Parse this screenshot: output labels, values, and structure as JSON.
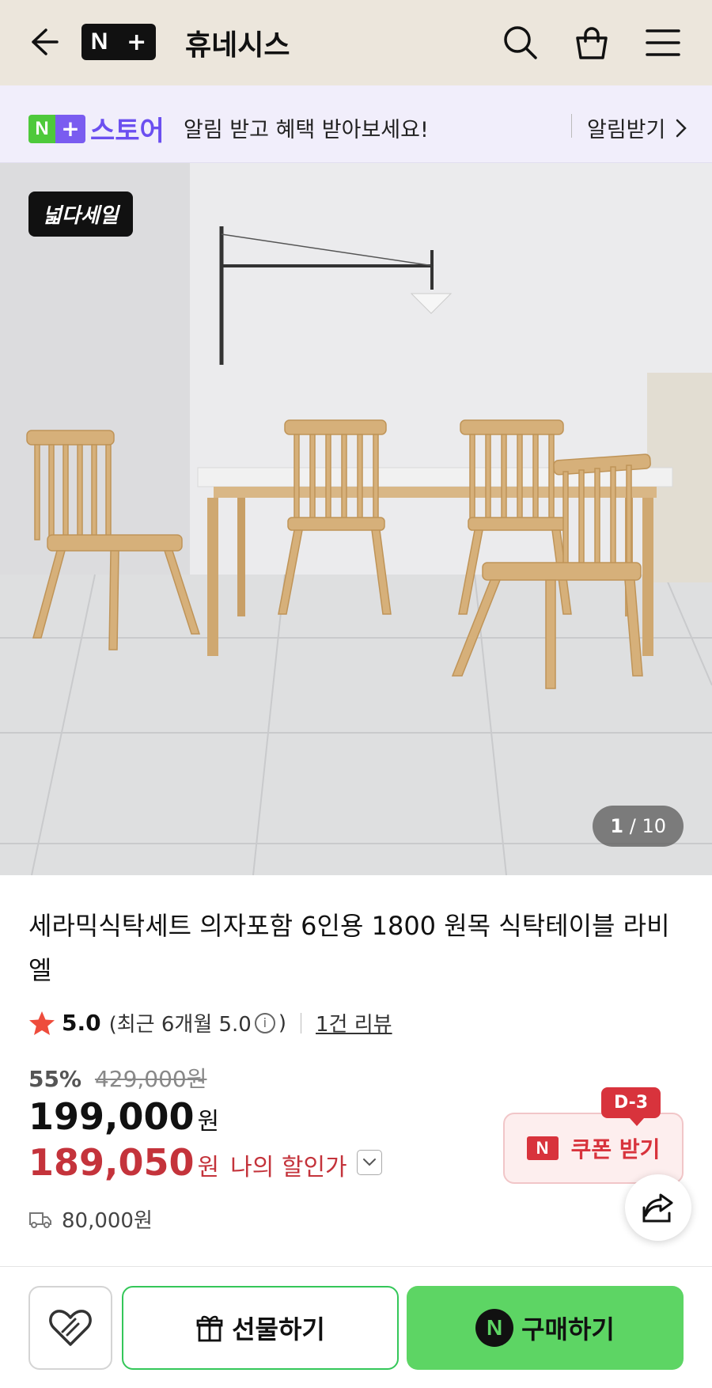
{
  "header": {
    "logo_n": "N",
    "logo_plus": "+",
    "store_name": "휴네시스",
    "icons": [
      "back-arrow-icon",
      "search-icon",
      "shopping-bag-icon",
      "menu-icon"
    ],
    "background_color": "#ece6dc"
  },
  "promo": {
    "logo_n": "N",
    "logo_plus": "+",
    "store_label": "스토어",
    "message": "알림 받고 혜택 받아보세요!",
    "action_label": "알림받기",
    "background_color": "#f1eefb",
    "accent_color": "#6b4ff0"
  },
  "gallery": {
    "badge": "넓다세일",
    "current": "1",
    "total": "/ 10"
  },
  "product": {
    "title": "세라믹식탁세트 의자포함 6인용 1800 원목 식탁테이블 라비엘",
    "rating": {
      "score": "5.0",
      "recent": "(최근 6개월 5.0",
      "recent_close": ")",
      "info_symbol": "i",
      "review_link": "1건 리뷰"
    },
    "discount_rate": "55%",
    "original_price": "429,000원",
    "price": "199,000",
    "currency": "원",
    "my_price": "189,050",
    "my_currency": "원",
    "my_price_label": "나의 할인가",
    "shipping_fee": "80,000원"
  },
  "coupon": {
    "d_day": "D-3",
    "logo_n": "N",
    "label": "쿠폰 받기",
    "color": "#d8333c"
  },
  "bottom_bar": {
    "gift_label": "선물하기",
    "buy_logo": "N",
    "buy_label": "구매하기",
    "buy_color": "#5dd564"
  }
}
